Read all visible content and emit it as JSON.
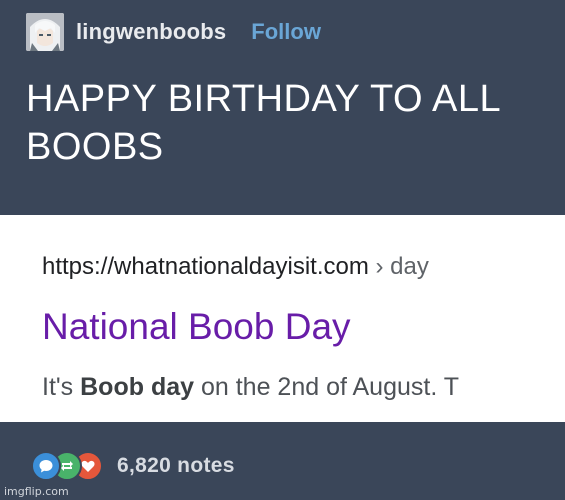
{
  "header": {
    "avatar": "anime-character-avatar",
    "username": "lingwenboobs",
    "follow_label": "Follow"
  },
  "post": {
    "text": "HAPPY BIRTHDAY TO ALL BOOBS"
  },
  "search_result": {
    "url": "https://whatnationaldayisit.com",
    "breadcrumb": " › day",
    "title": "National Boob Day",
    "snippet_prefix": "It's ",
    "snippet_bold": "Boob day",
    "snippet_suffix": " on the 2nd of August. T"
  },
  "footer": {
    "icons": [
      "reply-icon",
      "reblog-icon",
      "like-icon"
    ],
    "notes": "6,820 notes"
  },
  "watermark": "imgflip.com",
  "colors": {
    "background": "#3a4659",
    "follow": "#6aa6d6",
    "visited_link": "#681da8",
    "reply": "#3b8fd9",
    "reblog": "#49b36a",
    "like": "#e4573b"
  }
}
